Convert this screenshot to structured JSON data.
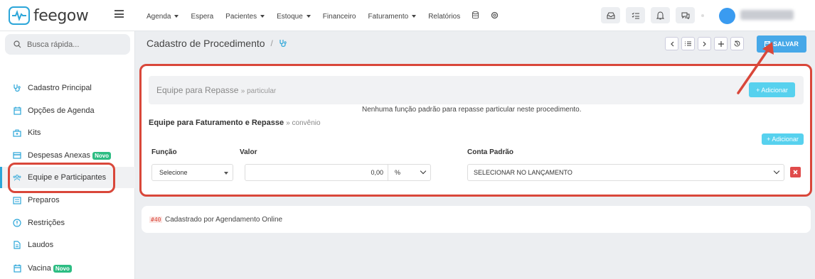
{
  "app": {
    "name": "feegow"
  },
  "nav": [
    {
      "label": "Agenda",
      "dropdown": true
    },
    {
      "label": "Espera",
      "dropdown": false
    },
    {
      "label": "Pacientes",
      "dropdown": true
    },
    {
      "label": "Estoque",
      "dropdown": true
    },
    {
      "label": "Financeiro",
      "dropdown": false
    },
    {
      "label": "Faturamento",
      "dropdown": true
    },
    {
      "label": "Relatórios",
      "dropdown": false
    }
  ],
  "sidebar": {
    "search_placeholder": "Busca rápida...",
    "items": [
      {
        "label": "Cadastro Principal",
        "icon": "stethoscope-icon"
      },
      {
        "label": "Opções de Agenda",
        "icon": "calendar-icon"
      },
      {
        "label": "Kits",
        "icon": "kit-icon"
      },
      {
        "label": "Despesas Anexas",
        "icon": "card-icon",
        "badge": "Novo"
      },
      {
        "label": "Equipe e Participantes",
        "icon": "team-icon",
        "active": true
      },
      {
        "label": "Preparos",
        "icon": "list-icon"
      },
      {
        "label": "Restrições",
        "icon": "alert-icon"
      },
      {
        "label": "Laudos",
        "icon": "document-icon"
      },
      {
        "label": "Vacina",
        "icon": "calendar-icon",
        "badge": "Novo"
      }
    ]
  },
  "page": {
    "title": "Cadastro de Procedimento",
    "save_label": "SALVAR"
  },
  "repasse": {
    "title": "Equipe para Repasse",
    "subtitle": "» particular",
    "add_label": "+ Adicionar",
    "empty_message": "Nenhuma função padrão para repasse particular neste procedimento."
  },
  "faturamento": {
    "title": "Equipe para Faturamento e Repasse",
    "subtitle": "» convênio",
    "add_label": "+ Adicionar",
    "columns": {
      "funcao": "Função",
      "valor": "Valor",
      "conta": "Conta Padrão"
    },
    "row": {
      "funcao": "Selecione",
      "valor": "0,00",
      "unit": "%",
      "conta": "SELECIONAR NO LANÇAMENTO"
    }
  },
  "footer": {
    "tag": "#40",
    "text": "Cadastrado por Agendamento Online"
  },
  "colors": {
    "accent": "#2ca6d9",
    "save": "#46a8e8",
    "add": "#57d1ee",
    "highlight": "#d9473a",
    "badge_new": "#2dbd83"
  }
}
